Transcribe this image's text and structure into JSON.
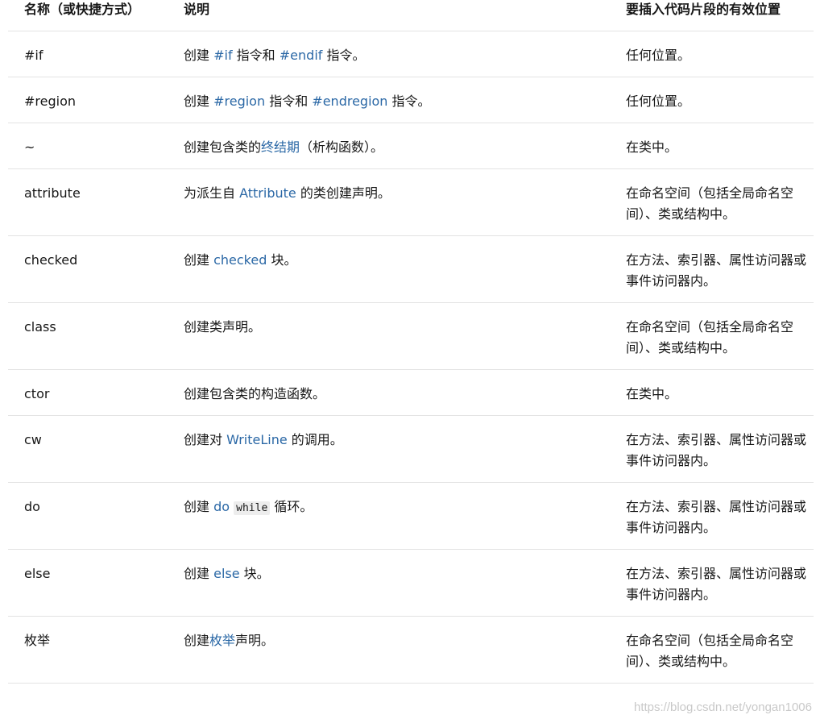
{
  "header": {
    "name": "名称（或快捷方式）",
    "desc": "说明",
    "location": "要插入代码片段的有效位置"
  },
  "rows": [
    {
      "name": "#if",
      "desc": [
        {
          "t": "创建 "
        },
        {
          "t": "#if",
          "link": true
        },
        {
          "t": " 指令和 "
        },
        {
          "t": "#endif",
          "link": true
        },
        {
          "t": " 指令。"
        }
      ],
      "location": "任何位置。"
    },
    {
      "name": "#region",
      "desc": [
        {
          "t": "创建 "
        },
        {
          "t": "#region",
          "link": true
        },
        {
          "t": " 指令和 "
        },
        {
          "t": "#endregion",
          "link": true
        },
        {
          "t": " 指令。"
        }
      ],
      "location": "任何位置。"
    },
    {
      "name": "~",
      "desc": [
        {
          "t": "创建包含类的"
        },
        {
          "t": "终结期",
          "link": true
        },
        {
          "t": "（析构函数）。"
        }
      ],
      "location": "在类中。"
    },
    {
      "name": "attribute",
      "desc": [
        {
          "t": "为派生自 "
        },
        {
          "t": "Attribute",
          "link": true
        },
        {
          "t": " 的类创建声明。"
        }
      ],
      "location": "在命名空间（包括全局命名空间）、类或结构中。"
    },
    {
      "name": "checked",
      "desc": [
        {
          "t": "创建 "
        },
        {
          "t": "checked",
          "link": true
        },
        {
          "t": " 块。"
        }
      ],
      "location": "在方法、索引器、属性访问器或事件访问器内。"
    },
    {
      "name": "class",
      "desc": [
        {
          "t": "创建类声明。"
        }
      ],
      "location": "在命名空间（包括全局命名空间）、类或结构中。"
    },
    {
      "name": "ctor",
      "desc": [
        {
          "t": "创建包含类的构造函数。"
        }
      ],
      "location": "在类中。"
    },
    {
      "name": "cw",
      "desc": [
        {
          "t": "创建对 "
        },
        {
          "t": "WriteLine",
          "link": true
        },
        {
          "t": " 的调用。"
        }
      ],
      "location": "在方法、索引器、属性访问器或事件访问器内。"
    },
    {
      "name": "do",
      "desc": [
        {
          "t": "创建 "
        },
        {
          "t": "do",
          "link": true
        },
        {
          "t": " "
        },
        {
          "t": "while",
          "code": true
        },
        {
          "t": " 循环。"
        }
      ],
      "location": "在方法、索引器、属性访问器或事件访问器内。"
    },
    {
      "name": "else",
      "desc": [
        {
          "t": "创建 "
        },
        {
          "t": "else",
          "link": true
        },
        {
          "t": " 块。"
        }
      ],
      "location": "在方法、索引器、属性访问器或事件访问器内。"
    },
    {
      "name": "枚举",
      "desc": [
        {
          "t": "创建"
        },
        {
          "t": "枚举",
          "link": true
        },
        {
          "t": "声明。"
        }
      ],
      "location": "在命名空间（包括全局命名空间）、类或结构中。"
    }
  ],
  "watermark": "https://blog.csdn.net/yongan1006",
  "colors": {
    "link": "#2b68a6",
    "border": "#e3e3e3",
    "text": "#171717"
  }
}
